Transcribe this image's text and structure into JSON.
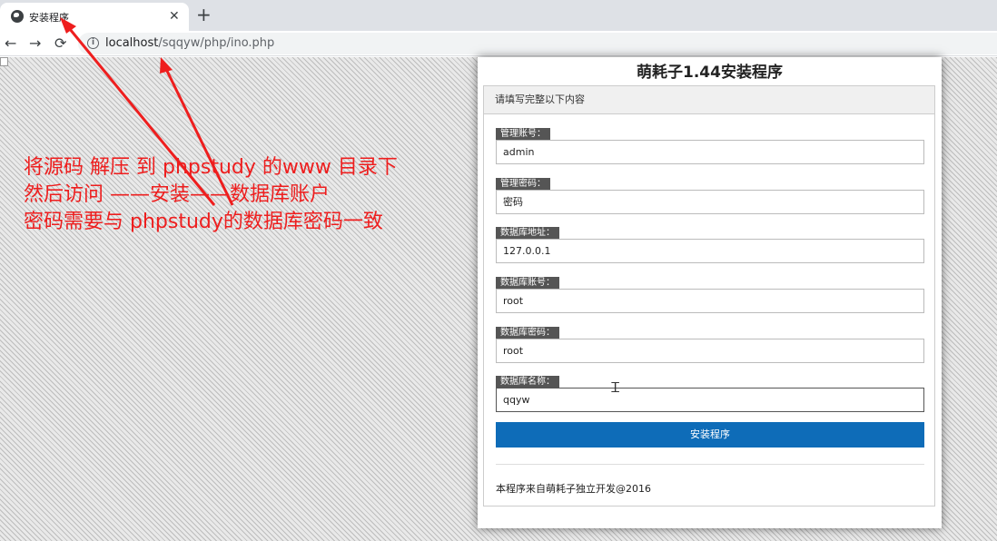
{
  "browser": {
    "tab_title": "安装程序",
    "tab_close": "✕",
    "new_tab": "+",
    "url_host": "localhost",
    "url_path": "/sqqyw/php/ino.php",
    "back": "←",
    "forward": "→",
    "reload": "⟳",
    "info": "i"
  },
  "annotation": {
    "line1": "将源码 解压 到 phpstudy 的www 目录下",
    "line2": "然后访问 ——安装——数据库账户",
    "line3": "密码需要与 phpstudy的数据库密码一致",
    "color": "#ee1e1e"
  },
  "install": {
    "title": "萌耗子1.44安装程序",
    "panel_header": "请填写完整以下内容",
    "fields": [
      {
        "label": "管理账号：",
        "value": "admin"
      },
      {
        "label": "管理密码：",
        "value": "密码"
      },
      {
        "label": "数据库地址：",
        "value": "127.0.0.1"
      },
      {
        "label": "数据库账号：",
        "value": "root"
      },
      {
        "label": "数据库密码：",
        "value": "root"
      },
      {
        "label": "数据库名称：",
        "value": "qqyw"
      }
    ],
    "submit_label": "安装程序",
    "footer": "本程序来自萌耗子独立开发@2016",
    "accent": "#0e6cb8"
  }
}
